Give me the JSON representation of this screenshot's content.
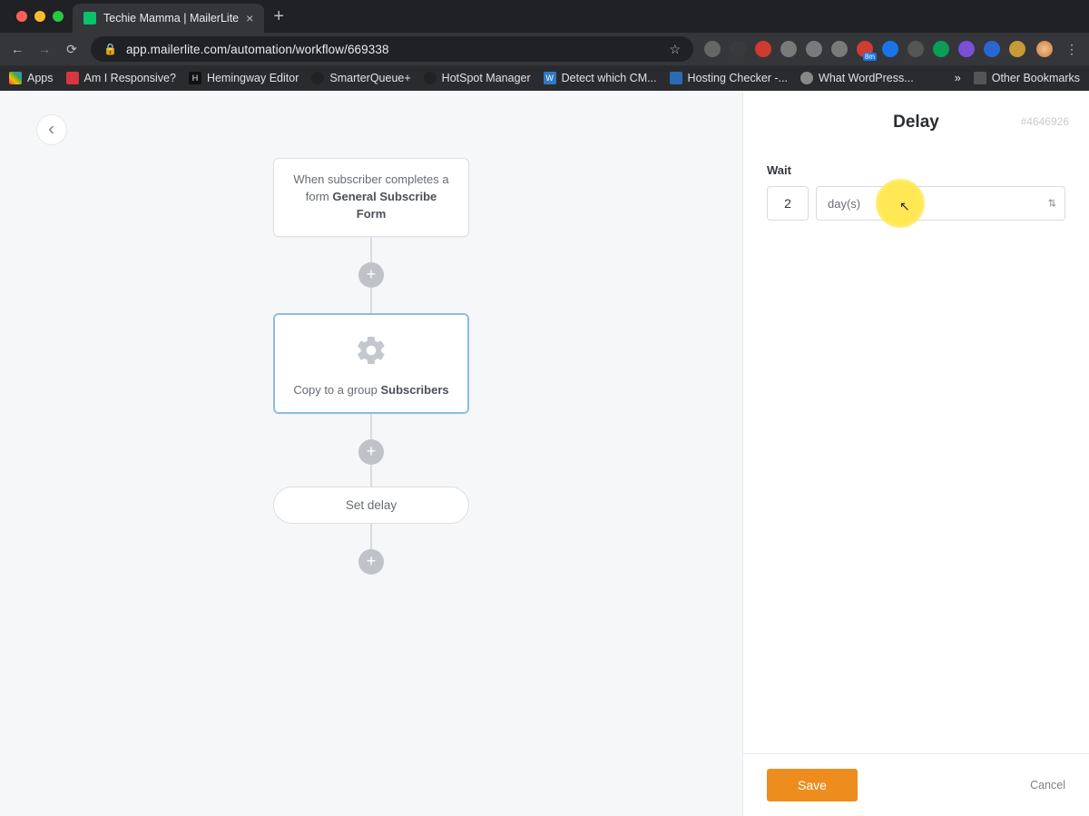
{
  "browser": {
    "tab_title": "Techie Mamma | MailerLite",
    "url": "app.mailerlite.com/automation/workflow/669338",
    "bookmarks": {
      "apps": "Apps",
      "b1": "Am I Responsive?",
      "b2": "Hemingway Editor",
      "b3": "SmarterQueue+",
      "b4": "HotSpot Manager",
      "b5": "Detect which CM...",
      "b6": "Hosting Checker -...",
      "b7": "What WordPress...",
      "overflow": "»",
      "other": "Other Bookmarks"
    }
  },
  "workflow": {
    "trigger_pre": "When subscriber completes a form ",
    "trigger_form": "General Subscribe Form",
    "action_pre": "Copy to a group ",
    "action_group": "Subscribers",
    "delay_label": "Set delay"
  },
  "panel": {
    "title": "Delay",
    "id": "#4646926",
    "wait_label": "Wait",
    "wait_value": "2",
    "wait_unit": "day(s)",
    "save": "Save",
    "cancel": "Cancel"
  }
}
